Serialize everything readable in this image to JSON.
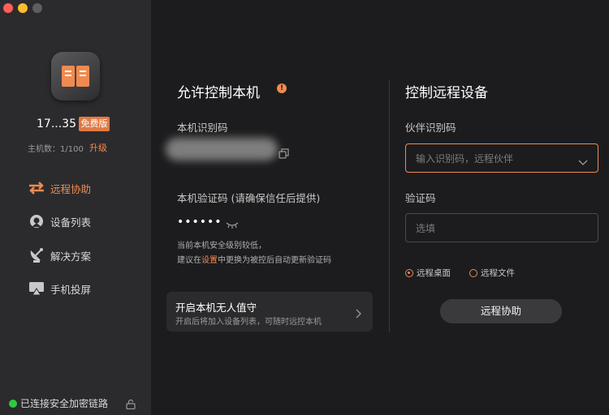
{
  "window": {
    "traffic_lights": {
      "close_color": "#ff5f57",
      "minimize_color": "#febc2e",
      "zoom_color": "#5e5e60"
    }
  },
  "app": {
    "icon": "book-icon",
    "accent": "#f08a50"
  },
  "account": {
    "id": "17...35",
    "plan_badge": "免费版",
    "host_count": "主机数：1/100",
    "upgrade_label": "升级"
  },
  "nav": [
    {
      "label": "远程协助",
      "icon": "swap-arrows-icon",
      "active": true
    },
    {
      "label": "设备列表",
      "icon": "device-list-icon",
      "active": false
    },
    {
      "label": "解决方案",
      "icon": "satellite-dish-icon",
      "active": false
    },
    {
      "label": "手机投屏",
      "icon": "screen-cast-icon",
      "active": false
    }
  ],
  "status": {
    "text": "已连接安全加密链路",
    "color": "#2ecc40"
  },
  "allow": {
    "title": "允许控制本机",
    "id_label": "本机识别码",
    "code_label": "本机验证码 (请确保信任后提供)",
    "code_masked": "••••••",
    "note_line1": "当前本机安全级别较低，",
    "note_line2_pre": "建议在",
    "note_line2_link": "设置",
    "note_line2_post": "中更换为被控后自动更新验证码",
    "unattended_title": "开启本机无人值守",
    "unattended_sub": "开启后将加入设备列表，可随时远控本机"
  },
  "control": {
    "title": "控制远程设备",
    "partner_label": "伙伴识别码",
    "partner_placeholder": "输入识别码，远程伙伴",
    "verify_label": "验证码",
    "verify_placeholder": "选填",
    "mode_desktop": "远程桌面",
    "mode_file": "远程文件",
    "selected_mode": "远程桌面",
    "submit_label": "远程协助"
  }
}
